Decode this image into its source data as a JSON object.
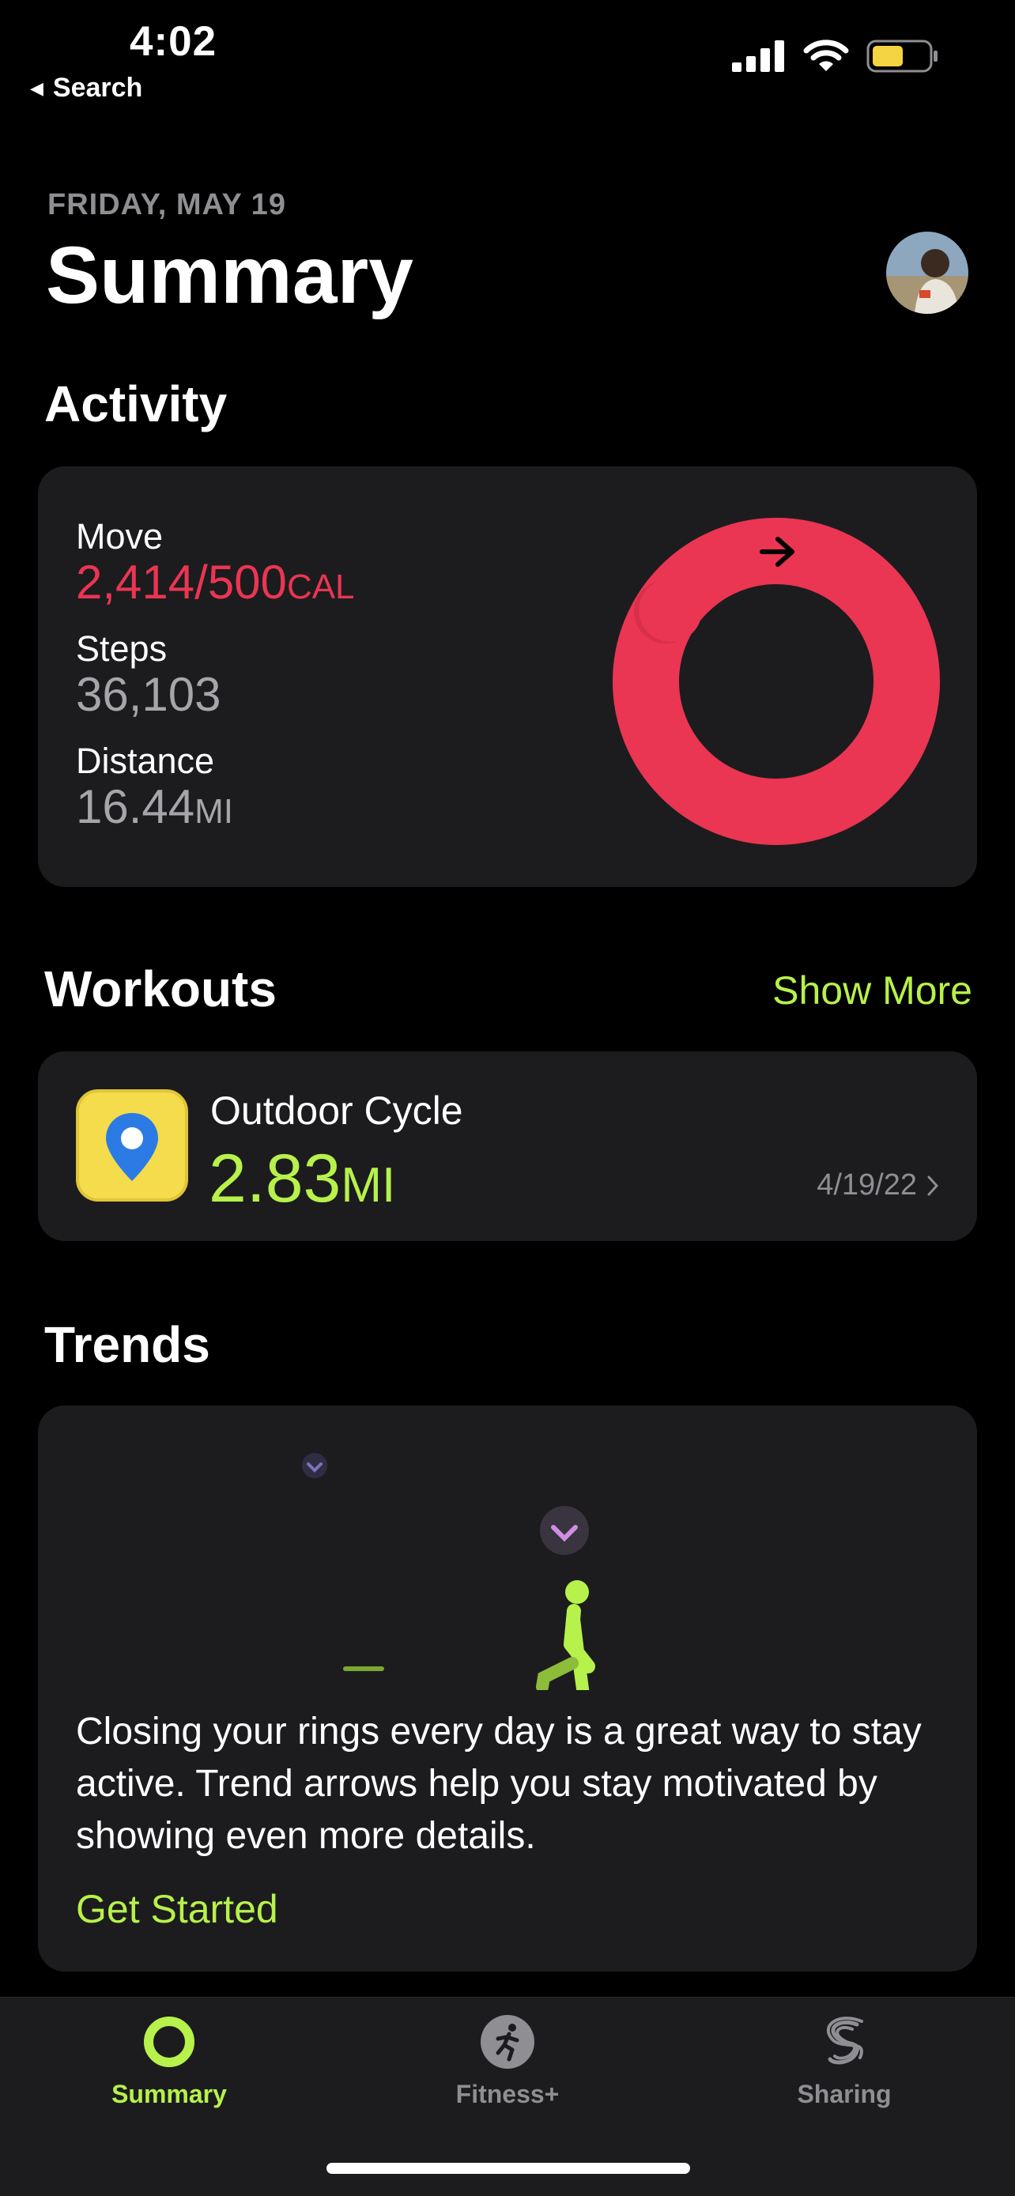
{
  "status_bar": {
    "time": "4:02",
    "back_label": "Search"
  },
  "header": {
    "date": "FRIDAY, MAY 19",
    "title": "Summary"
  },
  "activity": {
    "section_title": "Activity",
    "move": {
      "label": "Move",
      "value": "2,414/500",
      "unit": "CAL",
      "progress_fraction": 4.828
    },
    "steps": {
      "label": "Steps",
      "value": "36,103"
    },
    "distance": {
      "label": "Distance",
      "value": "16.44",
      "unit": "MI"
    }
  },
  "workouts": {
    "section_title": "Workouts",
    "show_more_label": "Show More",
    "item": {
      "name": "Outdoor Cycle",
      "value": "2.83",
      "unit": "MI",
      "date": "4/19/22"
    }
  },
  "trends": {
    "section_title": "Trends",
    "body": "Closing your rings every day is a great way to stay active. Trend arrows help you stay motivated by showing even more details.",
    "link_label": "Get Started"
  },
  "tab_bar": {
    "tabs": [
      {
        "label": "Summary",
        "icon": "activity-ring-icon",
        "active": true
      },
      {
        "label": "Fitness+",
        "icon": "runner-icon",
        "active": false
      },
      {
        "label": "Sharing",
        "icon": "sharing-icon",
        "active": false
      }
    ]
  },
  "colors": {
    "move": "#ea3553",
    "accent": "#b7f14b",
    "card": "#1c1c1e",
    "secondary_text": "#8e8e93"
  }
}
